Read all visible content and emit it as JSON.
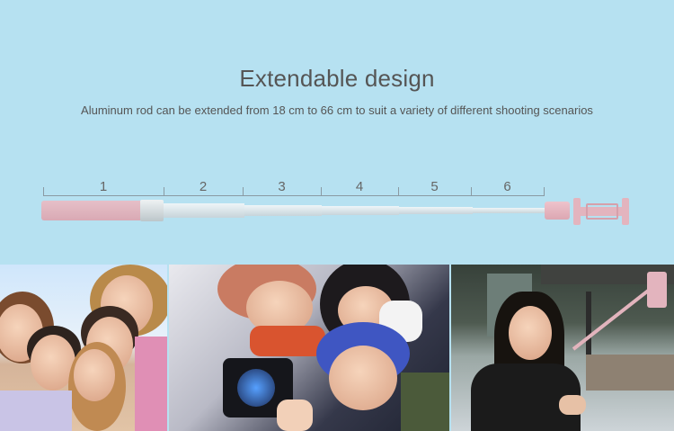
{
  "header": {
    "title": "Extendable design",
    "subtitle": "Aluminum rod can be extended from 18 cm to 66 cm to suit a variety of different shooting scenarios"
  },
  "ruler": {
    "segments": [
      "1",
      "2",
      "3",
      "4",
      "5",
      "6"
    ]
  },
  "colors": {
    "background": "#b6e1f1",
    "stick_pink": "#e3b4be",
    "rod_silver": "#c7d4da"
  },
  "photos": {
    "items": [
      "group-selfie-photo",
      "couple-camera-selfie-photo",
      "woman-selfie-stick-photo"
    ]
  }
}
